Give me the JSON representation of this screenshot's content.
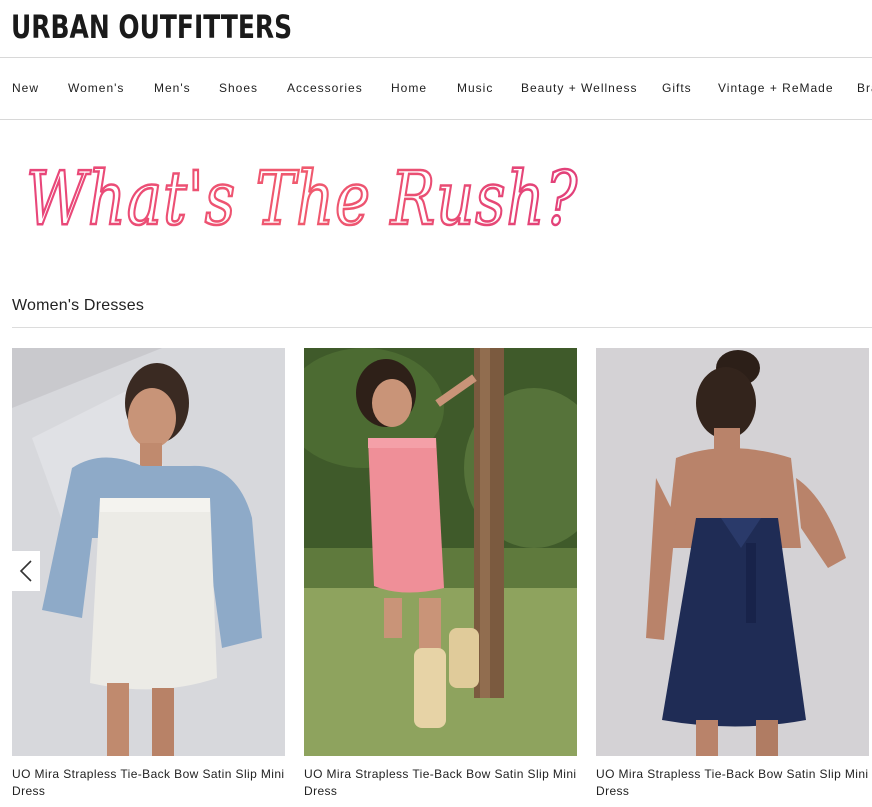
{
  "brand": {
    "logo_text": "URBAN OUTFITTERS"
  },
  "nav": {
    "items": [
      {
        "label": "New"
      },
      {
        "label": "Women's"
      },
      {
        "label": "Men's"
      },
      {
        "label": "Shoes"
      },
      {
        "label": "Accessories"
      },
      {
        "label": "Home"
      },
      {
        "label": "Music"
      },
      {
        "label": "Beauty + Wellness"
      },
      {
        "label": "Gifts"
      },
      {
        "label": "Vintage + ReMade"
      },
      {
        "label": "Bra"
      }
    ]
  },
  "hero": {
    "text": "What's The Rush?",
    "color": "#e8457a"
  },
  "section": {
    "title": "Women's Dresses"
  },
  "carousel": {
    "prev_icon": "chevron-left-icon",
    "products": [
      {
        "name": "UO Mira Strapless Tie-Back Bow Satin Slip Mini Dress",
        "dress_color": "#ece8df"
      },
      {
        "name": "UO Mira Strapless Tie-Back Bow Satin Slip Mini Dress",
        "dress_color": "#ef8f98"
      },
      {
        "name": "UO Mira Strapless Tie-Back Bow Satin Slip Mini Dress",
        "dress_color": "#1f2c55"
      }
    ]
  }
}
